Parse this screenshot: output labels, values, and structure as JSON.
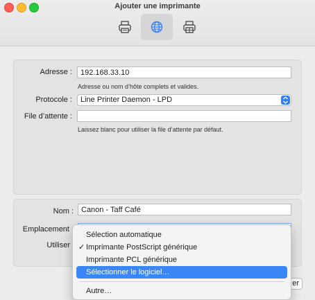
{
  "window": {
    "title": "Ajouter une imprimante"
  },
  "toolbar": {
    "items": [
      {
        "icon": "printer-icon",
        "selected": false
      },
      {
        "icon": "globe-icon",
        "selected": true
      },
      {
        "icon": "printer-windows-icon",
        "selected": false
      }
    ]
  },
  "form": {
    "address_label": "Adresse :",
    "address_value": "192.168.33.10",
    "address_hint": "Adresse ou nom d’hôte complets et valides.",
    "protocol_label": "Protocole :",
    "protocol_value": "Line Printer Daemon - LPD",
    "queue_label": "File d’attente :",
    "queue_value": "",
    "queue_hint": "Laissez blanc pour utiliser la file d’attente par défaut.",
    "name_label": "Nom :",
    "name_value": "Canon - Taff Café",
    "location_label": "Emplacement",
    "use_label": "Utiliser"
  },
  "menu": {
    "items": [
      {
        "label": "Sélection automatique",
        "checked": false,
        "highlighted": false
      },
      {
        "label": "Imprimante PostScript générique",
        "checked": true,
        "highlighted": false
      },
      {
        "label": "Imprimante PCL générique",
        "checked": false,
        "highlighted": false
      },
      {
        "label": "Sélectionner le logiciel…",
        "checked": false,
        "highlighted": true
      }
    ],
    "other_label": "Autre…",
    "checkmark": "✓"
  },
  "footer": {
    "add_button_partial": "er"
  },
  "colors": {
    "accent": "#3b86f7",
    "close": "#ff5f57",
    "minimize": "#febc2e",
    "maximize": "#28c840"
  }
}
